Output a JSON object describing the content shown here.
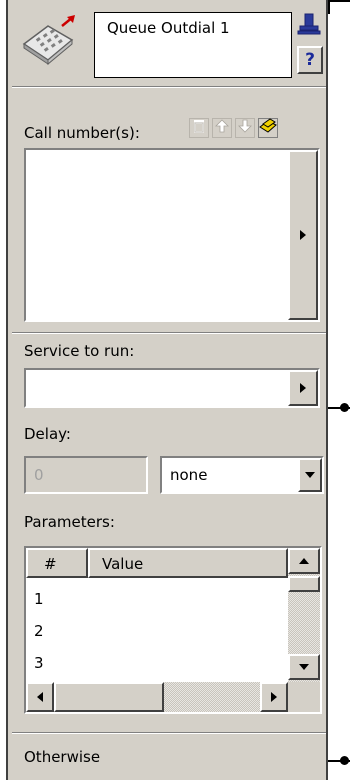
{
  "node": {
    "title": "Queue Outdial 1",
    "help_label": "?"
  },
  "call_numbers": {
    "label": "Call number(s):"
  },
  "service": {
    "label": "Service to run:",
    "value": ""
  },
  "delay": {
    "label": "Delay:",
    "value": "0",
    "unit_selected": "none"
  },
  "parameters": {
    "label": "Parameters:",
    "columns": [
      "#",
      "Value"
    ],
    "rows": [
      {
        "num": "1",
        "value": ""
      },
      {
        "num": "2",
        "value": ""
      },
      {
        "num": "3",
        "value": ""
      }
    ]
  },
  "otherwise": {
    "label": "Otherwise"
  },
  "icons": [
    "phone-icon",
    "lock-icon",
    "delete-icon",
    "move-up-icon",
    "move-down-icon",
    "add-number-icon"
  ]
}
